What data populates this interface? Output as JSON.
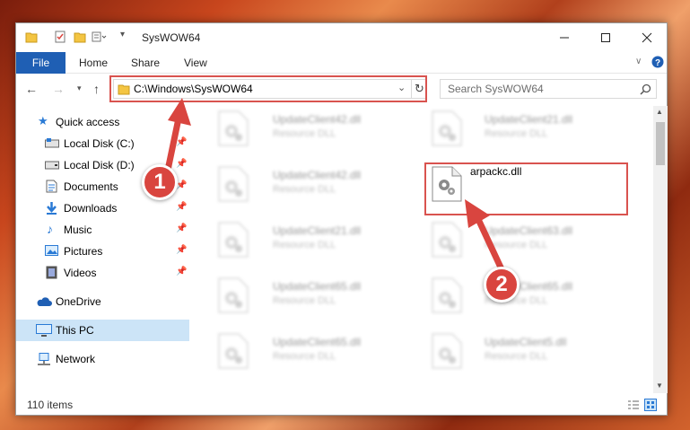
{
  "window": {
    "title": "SysWOW64"
  },
  "ribbon": {
    "file": "File",
    "tabs": [
      "Home",
      "Share",
      "View"
    ]
  },
  "address": {
    "path": "C:\\Windows\\SysWOW64"
  },
  "search": {
    "placeholder": "Search SysWOW64"
  },
  "sidebar": {
    "quick_access": "Quick access",
    "items": [
      {
        "label": "Local Disk (C:)",
        "pinned": true
      },
      {
        "label": "Local Disk (D:)",
        "pinned": true
      },
      {
        "label": "Documents",
        "pinned": true
      },
      {
        "label": "Downloads",
        "pinned": true
      },
      {
        "label": "Music",
        "pinned": true
      },
      {
        "label": "Pictures",
        "pinned": true
      },
      {
        "label": "Videos",
        "pinned": true
      }
    ],
    "onedrive": "OneDrive",
    "this_pc": "This PC",
    "network": "Network"
  },
  "files": {
    "left": [
      {
        "name": "UpdateClient42.dll",
        "type": "Resource DLL"
      },
      {
        "name": "UpdateClient42.dll",
        "type": "Resource DLL"
      },
      {
        "name": "UpdateClient21.dll",
        "type": "Resource DLL"
      },
      {
        "name": "UpdateClient65.dll",
        "type": "Resource DLL"
      },
      {
        "name": "UpdateClient65.dll",
        "type": "Resource DLL"
      }
    ],
    "right": [
      {
        "name": "UpdateClient21.dll",
        "type": "Resource DLL"
      },
      {
        "name": "arpackc.dll",
        "type": ""
      },
      {
        "name": "UpdateClient63.dll",
        "type": "Resource DLL"
      },
      {
        "name": "UpdateClient65.dll",
        "type": "Resource DLL"
      },
      {
        "name": "UpdateClient5.dll",
        "type": "Resource DLL"
      }
    ]
  },
  "status": {
    "count": "110 items"
  },
  "annotations": {
    "step1": "1",
    "step2": "2"
  }
}
